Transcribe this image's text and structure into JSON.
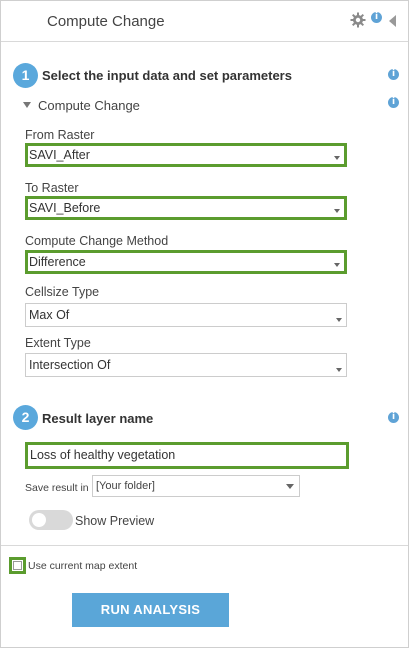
{
  "header": {
    "title": "Compute Change"
  },
  "step1": {
    "number": "1",
    "title": "Select the input data and set parameters",
    "section_label": "Compute Change",
    "from_raster": {
      "label": "From Raster",
      "value": "SAVI_After"
    },
    "to_raster": {
      "label": "To Raster",
      "value": "SAVI_Before"
    },
    "method": {
      "label": "Compute Change Method",
      "value": "Difference"
    },
    "cellsize": {
      "label": "Cellsize Type",
      "value": "Max Of"
    },
    "extent": {
      "label": "Extent Type",
      "value": "Intersection Of"
    }
  },
  "step2": {
    "number": "2",
    "title": "Result layer name",
    "name_value": "Loss of healthy vegetation",
    "save_label": "Save result in",
    "folder_value": "[Your folder]"
  },
  "preview": {
    "label": "Show Preview",
    "enabled": false
  },
  "footer": {
    "extent_label": "Use current map extent",
    "extent_checked": false,
    "run_label": "RUN ANALYSIS"
  },
  "colors": {
    "accent_blue": "#5aa6d8",
    "highlight_green": "#5b9c2e"
  }
}
